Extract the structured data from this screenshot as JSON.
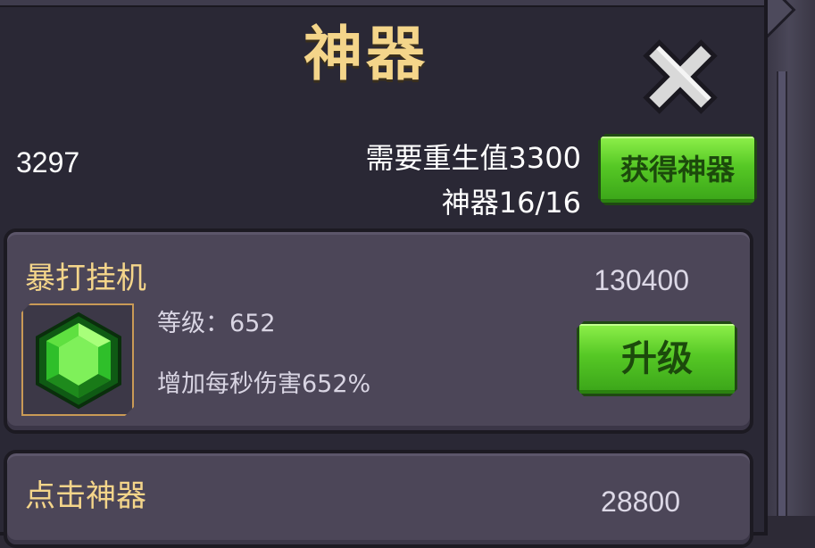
{
  "header": {
    "title": "神器",
    "close_icon": "close-x-icon"
  },
  "stats": {
    "currency": "3297",
    "requirement": "需要重生值3300",
    "artifact_count": "神器16/16"
  },
  "actions": {
    "get_artifact_label": "获得神器"
  },
  "artifacts": [
    {
      "name": "暴打挂机",
      "cost": "130400",
      "level": "等级：652",
      "description": "增加每秒伤害652%",
      "upgrade_label": "升级",
      "icon": "green-gem-icon"
    },
    {
      "name": "点击神器",
      "cost": "28800"
    }
  ],
  "colors": {
    "title_gold": "#f4d58a",
    "button_green": "#56c825",
    "panel_bg": "#2a2835",
    "card_bg": "#4c4658"
  }
}
